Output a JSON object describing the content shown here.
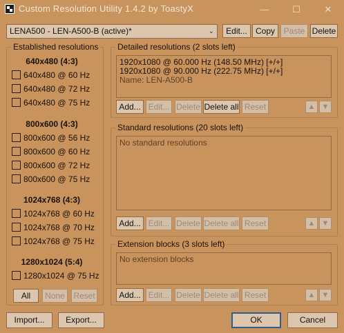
{
  "window": {
    "title": "Custom Resolution Utility 1.4.2 by ToastyX",
    "minimize_icon": "minimize-icon",
    "maximize_icon": "maximize-icon",
    "close_icon": "close-icon"
  },
  "toolbar": {
    "monitor_selected": "LENA500 - LEN-A500-B (active)*",
    "edit_label": "Edit...",
    "copy_label": "Copy",
    "paste_label": "Paste",
    "delete_label": "Delete"
  },
  "established": {
    "title": "Established resolutions",
    "groups": [
      {
        "heading": "640x480 (4:3)",
        "items": [
          "640x480 @ 60 Hz",
          "640x480 @ 72 Hz",
          "640x480 @ 75 Hz"
        ]
      },
      {
        "heading": "800x600 (4:3)",
        "items": [
          "800x600 @ 56 Hz",
          "800x600 @ 60 Hz",
          "800x600 @ 72 Hz",
          "800x600 @ 75 Hz"
        ]
      },
      {
        "heading": "1024x768 (4:3)",
        "items": [
          "1024x768 @ 60 Hz",
          "1024x768 @ 70 Hz",
          "1024x768 @ 75 Hz"
        ]
      },
      {
        "heading": "1280x1024 (5:4)",
        "items": [
          "1280x1024 @ 75 Hz"
        ]
      }
    ],
    "all_label": "All",
    "none_label": "None",
    "reset_label": "Reset"
  },
  "detailed": {
    "title": "Detailed resolutions (2 slots left)",
    "entries": [
      "1920x1080 @ 60.000 Hz (148.50 MHz) [+/+]",
      "1920x1080 @ 90.000 Hz (222.75 MHz) [+/+]"
    ],
    "name_line": "Name: LEN-A500-B",
    "add_label": "Add...",
    "edit_label": "Edit...",
    "delete_label": "Delete",
    "delete_all_label": "Delete all",
    "reset_label": "Reset"
  },
  "standard": {
    "title": "Standard resolutions (20 slots left)",
    "empty_text": "No standard resolutions",
    "add_label": "Add...",
    "edit_label": "Edit...",
    "delete_label": "Delete",
    "delete_all_label": "Delete all",
    "reset_label": "Reset"
  },
  "extension": {
    "title": "Extension blocks (3 slots left)",
    "empty_text": "No extension blocks",
    "add_label": "Add...",
    "edit_label": "Edit...",
    "delete_label": "Delete",
    "delete_all_label": "Delete all",
    "reset_label": "Reset"
  },
  "footer": {
    "import_label": "Import...",
    "export_label": "Export...",
    "ok_label": "OK",
    "cancel_label": "Cancel"
  },
  "colors": {
    "background": "#c8935c",
    "button": "#dcc7ae",
    "default_border": "#2f5e8c"
  }
}
